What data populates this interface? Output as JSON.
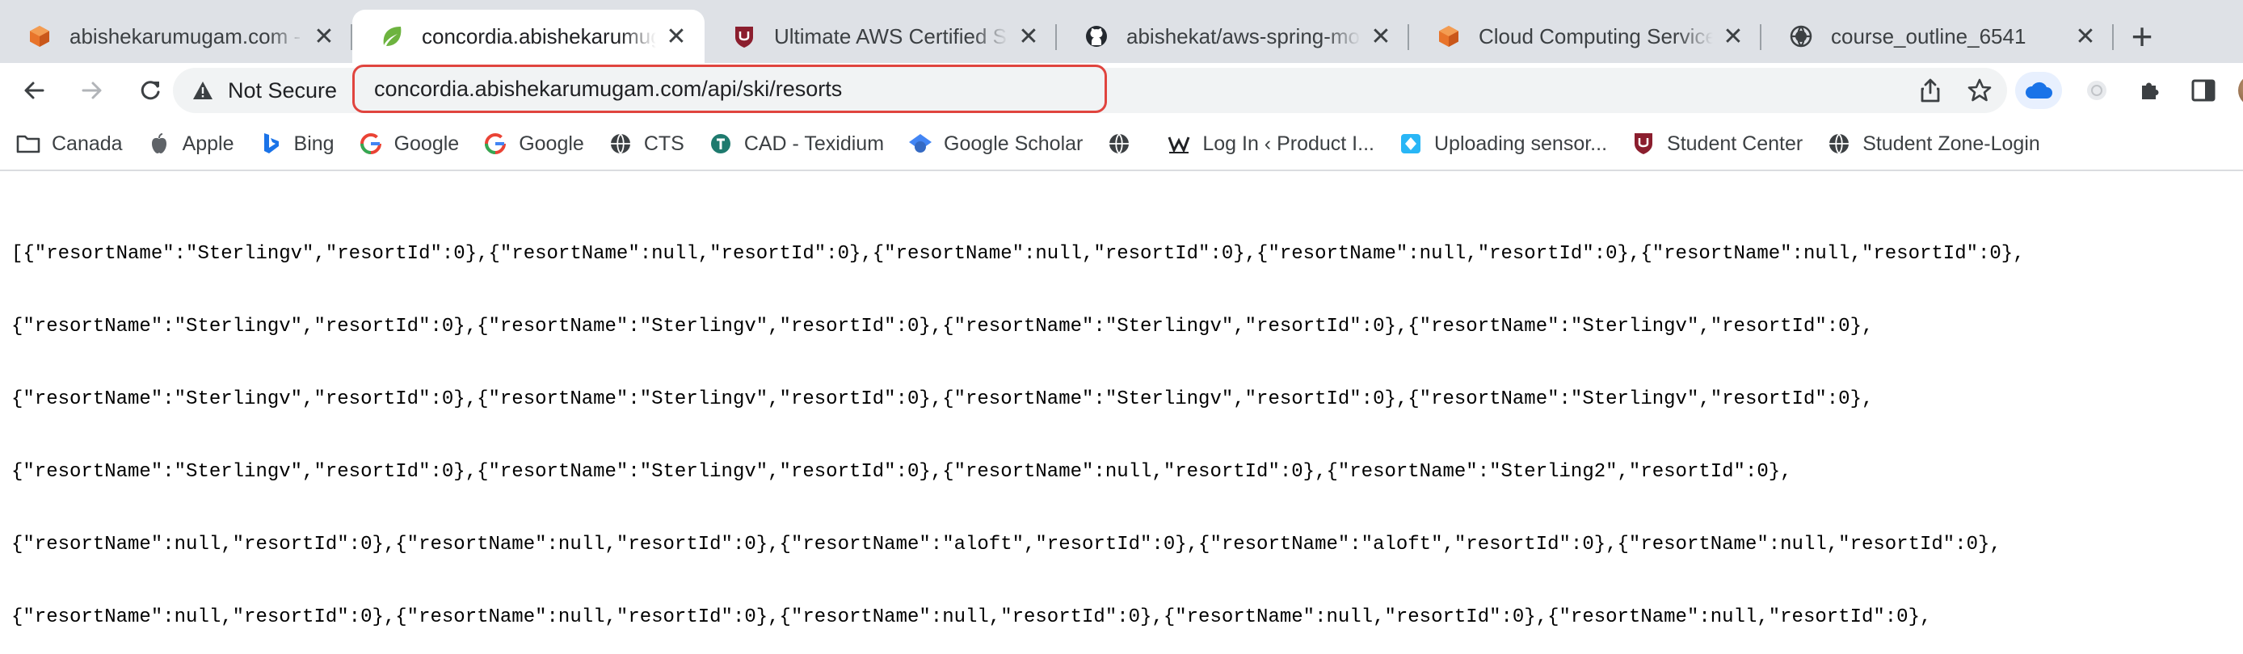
{
  "tabs": [
    {
      "title": "abishekarumugam.com - dc",
      "icon": "aws-cube-icon",
      "color": "#e8742b",
      "active": false
    },
    {
      "title": "concordia.abishekarumuga",
      "icon": "spring-leaf-icon",
      "color": "#6db33f",
      "active": true
    },
    {
      "title": "Ultimate AWS Certified Solu",
      "icon": "udemy-shield-icon",
      "color": "#8b1e2e",
      "active": false
    },
    {
      "title": "abishekat/aws-spring-mon",
      "icon": "github-icon",
      "color": "#24292f",
      "active": false
    },
    {
      "title": "Cloud Computing Services",
      "icon": "aws-cube-icon",
      "color": "#e8742b",
      "active": false
    },
    {
      "title": "course_outline_6541",
      "icon": "globe-icon",
      "color": "#5f6368",
      "active": false
    }
  ],
  "toolbar": {
    "security_label": "Not Secure",
    "url": "concordia.abishekarumugam.com/api/ski/resorts"
  },
  "bookmarks": [
    {
      "label": "Canada",
      "icon": "folder-icon"
    },
    {
      "label": "Apple",
      "icon": "apple-icon"
    },
    {
      "label": "Bing",
      "icon": "bing-icon"
    },
    {
      "label": "Google",
      "icon": "google-icon"
    },
    {
      "label": "Google",
      "icon": "google-icon"
    },
    {
      "label": "CTS",
      "icon": "globe-icon"
    },
    {
      "label": "CAD - Texidium",
      "icon": "texidium-icon"
    },
    {
      "label": "Google Scholar",
      "icon": "scholar-icon"
    },
    {
      "label": "",
      "icon": "globe-icon"
    },
    {
      "label": "Log In ‹ Product I...",
      "icon": "product-icon"
    },
    {
      "label": "Uploading sensor...",
      "icon": "sensor-icon"
    },
    {
      "label": "Student Center",
      "icon": "udemy-shield-icon"
    },
    {
      "label": "Student Zone-Login",
      "icon": "globe-icon"
    }
  ],
  "json_lines": [
    "[{\"resortName\":\"Sterlingv\",\"resortId\":0},{\"resortName\":null,\"resortId\":0},{\"resortName\":null,\"resortId\":0},{\"resortName\":null,\"resortId\":0},{\"resortName\":null,\"resortId\":0},",
    "{\"resortName\":\"Sterlingv\",\"resortId\":0},{\"resortName\":\"Sterlingv\",\"resortId\":0},{\"resortName\":\"Sterlingv\",\"resortId\":0},{\"resortName\":\"Sterlingv\",\"resortId\":0},",
    "{\"resortName\":\"Sterlingv\",\"resortId\":0},{\"resortName\":\"Sterlingv\",\"resortId\":0},{\"resortName\":\"Sterlingv\",\"resortId\":0},{\"resortName\":\"Sterlingv\",\"resortId\":0},",
    "{\"resortName\":\"Sterlingv\",\"resortId\":0},{\"resortName\":\"Sterlingv\",\"resortId\":0},{\"resortName\":null,\"resortId\":0},{\"resortName\":\"Sterling2\",\"resortId\":0},",
    "{\"resortName\":null,\"resortId\":0},{\"resortName\":null,\"resortId\":0},{\"resortName\":\"aloft\",\"resortId\":0},{\"resortName\":\"aloft\",\"resortId\":0},{\"resortName\":null,\"resortId\":0},",
    "{\"resortName\":null,\"resortId\":0},{\"resortName\":null,\"resortId\":0},{\"resortName\":null,\"resortId\":0},{\"resortName\":null,\"resortId\":0},{\"resortName\":null,\"resortId\":0},"
  ]
}
